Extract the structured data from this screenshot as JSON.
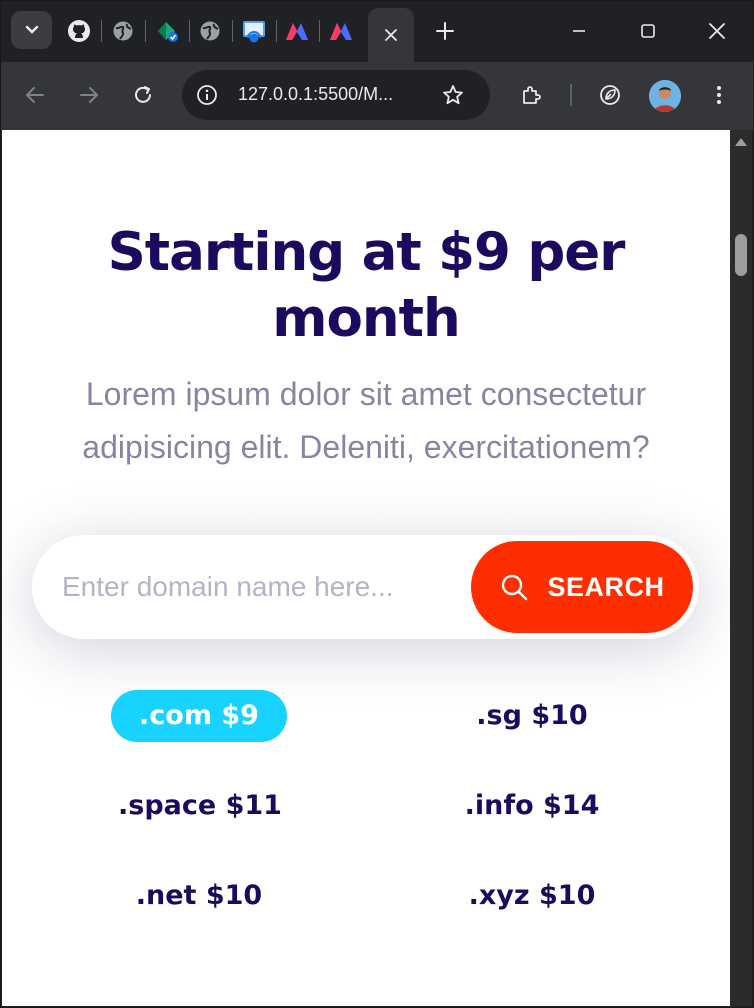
{
  "browser": {
    "url": "127.0.0.1:5500/M...",
    "colors": {
      "frame": "#202124",
      "toolbar": "#35363a"
    },
    "window_controls": [
      "minimize-icon",
      "maximize-icon",
      "close-icon"
    ]
  },
  "page": {
    "title": "Starting at $9 per month",
    "subtitle": "Lorem ipsum dolor sit amet consectetur adipisicing elit. Deleniti, exercitationem?",
    "search": {
      "placeholder": "Enter domain name here...",
      "button_label": "SEARCH"
    },
    "domains": [
      {
        "label": ".com $9",
        "active": true
      },
      {
        "label": ".sg $10",
        "active": false
      },
      {
        "label": ".space $11",
        "active": false
      },
      {
        "label": ".info $14",
        "active": false
      },
      {
        "label": ".net $10",
        "active": false
      },
      {
        "label": ".xyz $10",
        "active": false
      }
    ],
    "colors": {
      "heading": "#1c0a5e",
      "subtitle": "#8a84a3",
      "button": "#ff2e00",
      "active_domain": "#18d2ff"
    }
  }
}
